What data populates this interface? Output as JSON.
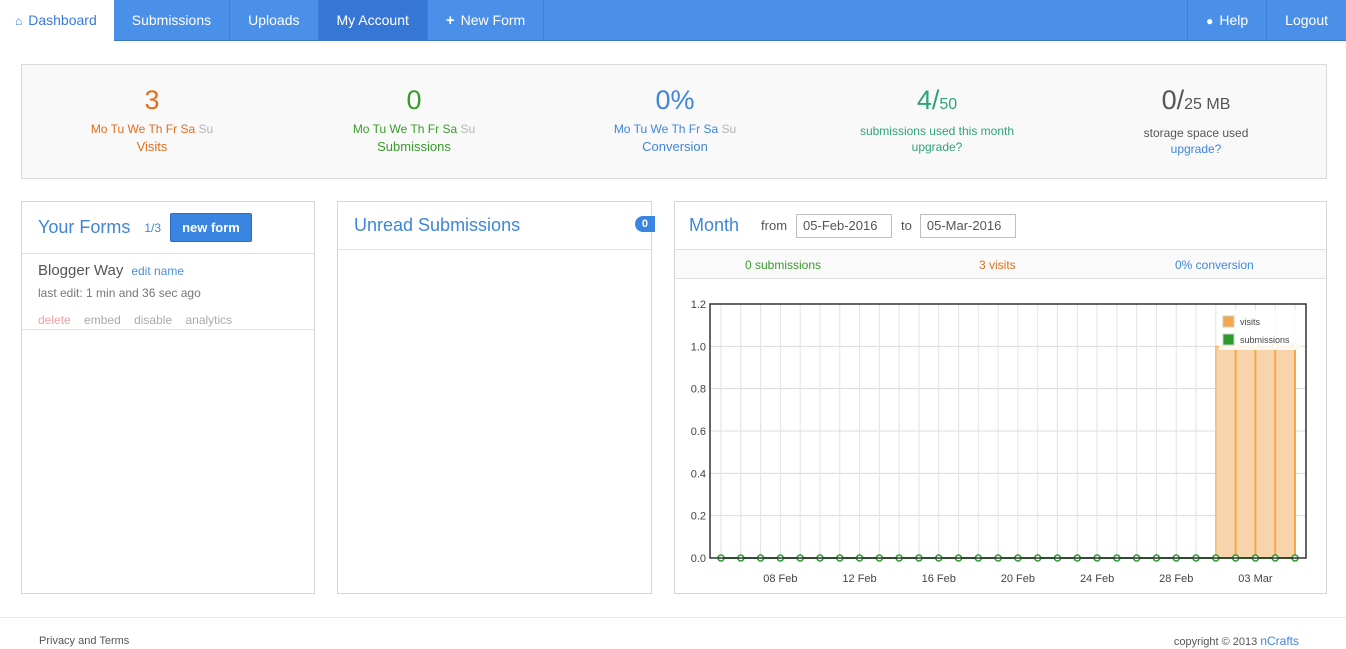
{
  "nav": {
    "dashboard": "Dashboard",
    "submissions": "Submissions",
    "uploads": "Uploads",
    "account": "My Account",
    "new_form": "New Form",
    "help": "Help",
    "logout": "Logout"
  },
  "stats": {
    "visits": {
      "value": "3",
      "label": "Visits"
    },
    "submissions": {
      "value": "0",
      "label": "Submissions"
    },
    "conversion": {
      "value": "0%",
      "label": "Conversion"
    },
    "usage": {
      "value": "4/",
      "denom": "50",
      "label": "submissions used this month",
      "link": "upgrade?"
    },
    "storage": {
      "value": "0/",
      "denom": "25 MB",
      "label": "storage space used",
      "link": "upgrade?"
    },
    "days_active": [
      "Mo",
      "Tu",
      "We",
      "Th",
      "Fr",
      "Sa"
    ],
    "day_off": "Su"
  },
  "forms": {
    "title": "Your Forms",
    "count": "1/3",
    "new_button": "new form",
    "items": [
      {
        "name": "Blogger Way",
        "edit": "edit name",
        "last_edit": "last edit: 1 min and 36 sec ago",
        "actions": [
          "delete",
          "embed",
          "disable",
          "analytics"
        ]
      }
    ]
  },
  "unread": {
    "title": "Unread Submissions",
    "badge": "0"
  },
  "month": {
    "title": "Month",
    "from_label": "from",
    "from_value": "05-Feb-2016",
    "to_label": "to",
    "to_value": "05-Mar-2016",
    "summary_submissions": "0 submissions",
    "summary_visits": "3 visits",
    "summary_conversion": "0% conversion"
  },
  "chart_data": {
    "type": "area",
    "x_ticks": [
      "08 Feb",
      "12 Feb",
      "16 Feb",
      "20 Feb",
      "24 Feb",
      "28 Feb",
      "03 Mar"
    ],
    "y_ticks": [
      "0.0",
      "0.2",
      "0.4",
      "0.6",
      "0.8",
      "1.0",
      "1.2"
    ],
    "ylim": [
      0,
      1.2
    ],
    "series": [
      {
        "name": "visits",
        "color": "#f5a84a",
        "values": [
          0,
          0,
          0,
          0,
          0,
          0,
          0,
          0,
          0,
          0,
          0,
          0,
          0,
          0,
          0,
          0,
          0,
          0,
          0,
          0,
          0,
          0,
          0,
          0,
          0,
          0,
          1,
          1,
          1,
          1
        ]
      },
      {
        "name": "submissions",
        "color": "#2a9a2a",
        "values": [
          0,
          0,
          0,
          0,
          0,
          0,
          0,
          0,
          0,
          0,
          0,
          0,
          0,
          0,
          0,
          0,
          0,
          0,
          0,
          0,
          0,
          0,
          0,
          0,
          0,
          0,
          0,
          0,
          0,
          0
        ]
      }
    ],
    "legend": "top-right"
  },
  "footer": {
    "privacy": "Privacy and Terms",
    "copyright": "copyright © 2013",
    "brand": "nCrafts"
  }
}
